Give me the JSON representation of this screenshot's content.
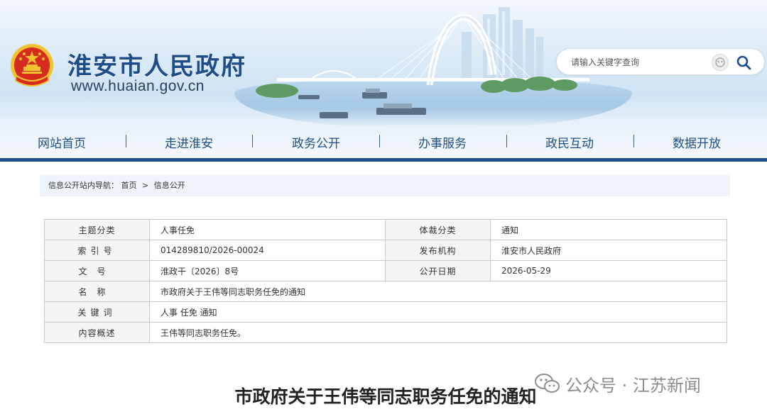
{
  "site": {
    "name": "淮安市人民政府",
    "url": "www.huaian.gov.cn"
  },
  "search": {
    "placeholder": "请输入关键字查询"
  },
  "nav": {
    "items": [
      "网站首页",
      "走进淮安",
      "政务公开",
      "办事服务",
      "政民互动",
      "数据开放"
    ],
    "separator": "|"
  },
  "breadcrumb": {
    "lead": "信息公开站内导航：",
    "home": "首页",
    "sep": ">",
    "current": "信息公开"
  },
  "info": {
    "subject_label": "主题分类",
    "subject_value": "人事任免",
    "genre_label": "体裁分类",
    "genre_value": "通知",
    "index_label": "索引号",
    "index_value": "014289810/2026-00024",
    "publisher_label": "发布机构",
    "publisher_value": "淮安市人民政府",
    "docno_label": "文号",
    "docno_value": "淮政干〔2026〕8号",
    "date_label": "公开日期",
    "date_value": "2026-05-29",
    "name_label": "名称",
    "name_value": "市政府关于王伟等同志职务任免的通知",
    "keywords_label": "关键词",
    "keywords_value": "人事 任免 通知",
    "summary_label": "内容概述",
    "summary_value": "王伟等同志职务任免。"
  },
  "article": {
    "title": "市政府关于王伟等同志职务任免的通知"
  },
  "watermark": {
    "text": "公众号 · 江苏新闻"
  },
  "colors": {
    "primary": "#1c4f8c",
    "nav_text": "#1f4f86",
    "emblem_red": "#d72b1f",
    "emblem_gold": "#f2c230"
  }
}
